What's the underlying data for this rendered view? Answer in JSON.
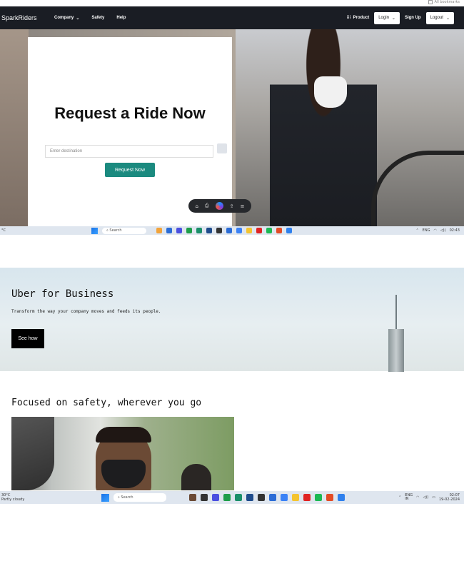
{
  "top_strip": {
    "checkbox_label": "All bookmarks"
  },
  "nav": {
    "brand": "SparkRiders",
    "links": [
      "Company",
      "Safety",
      "Help"
    ],
    "product": "Product",
    "login": "Login",
    "signup": "Sign Up",
    "logout": "Logout"
  },
  "hero": {
    "title": "Request a Ride Now",
    "destination_placeholder": "Enter destination",
    "request_button": "Request Now"
  },
  "taskbar_top": {
    "weather": "°C",
    "search": "Search",
    "lang": "ENG",
    "time": "02:43"
  },
  "business": {
    "title": "Uber for Business",
    "subtitle": "Transform the way your company moves and feeds its people.",
    "button": "See how"
  },
  "safety": {
    "title": "Focused on safety, wherever you go"
  },
  "taskbar_bottom": {
    "temp": "30°C",
    "weather": "Partly cloudy",
    "search": "Search",
    "lang": "ENG",
    "region": "IN",
    "time": "02:07",
    "date": "19-02-2024"
  },
  "colors": {
    "nav_bg": "#1a1d24",
    "accent": "#1b8a7f"
  }
}
